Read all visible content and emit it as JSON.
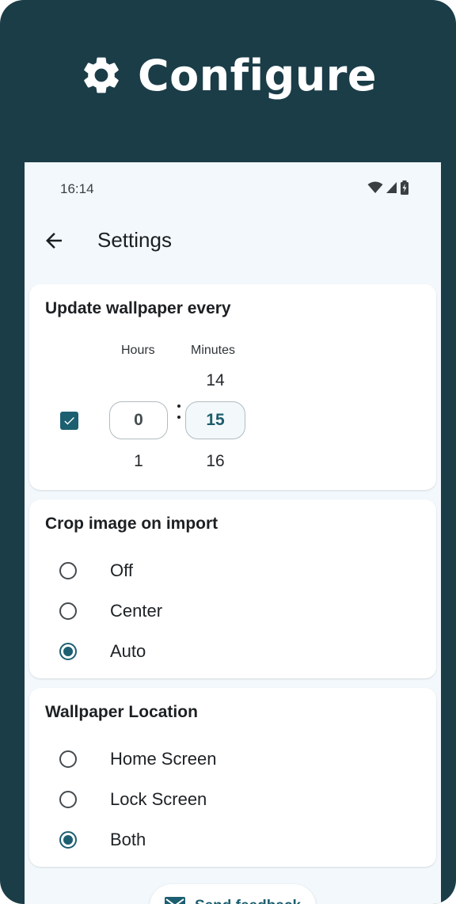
{
  "hero": {
    "title": "Configure",
    "icon": "gear-icon"
  },
  "status_bar": {
    "time": "16:14",
    "icons": [
      "wifi-icon",
      "cell-signal-icon",
      "battery-charging-icon"
    ]
  },
  "app_bar": {
    "title": "Settings",
    "back_icon": "arrow-back-icon"
  },
  "update_card": {
    "title": "Update wallpaper every",
    "enabled": true,
    "hours_label": "Hours",
    "minutes_label": "Minutes",
    "hours": {
      "above": "",
      "value": "0",
      "below": "1"
    },
    "minutes": {
      "above": "14",
      "value": "15",
      "below": "16"
    }
  },
  "crop_card": {
    "title": "Crop image on import",
    "options": [
      {
        "label": "Off",
        "selected": false
      },
      {
        "label": "Center",
        "selected": false
      },
      {
        "label": "Auto",
        "selected": true
      }
    ]
  },
  "location_card": {
    "title": "Wallpaper Location",
    "options": [
      {
        "label": "Home Screen",
        "selected": false
      },
      {
        "label": "Lock Screen",
        "selected": false
      },
      {
        "label": "Both",
        "selected": true
      }
    ]
  },
  "feedback_button": {
    "label": "Send feedback",
    "icon": "mail-icon"
  },
  "colors": {
    "background": "#1b3d48",
    "accent": "#1c5f70",
    "screen": "#f2f8fb"
  }
}
